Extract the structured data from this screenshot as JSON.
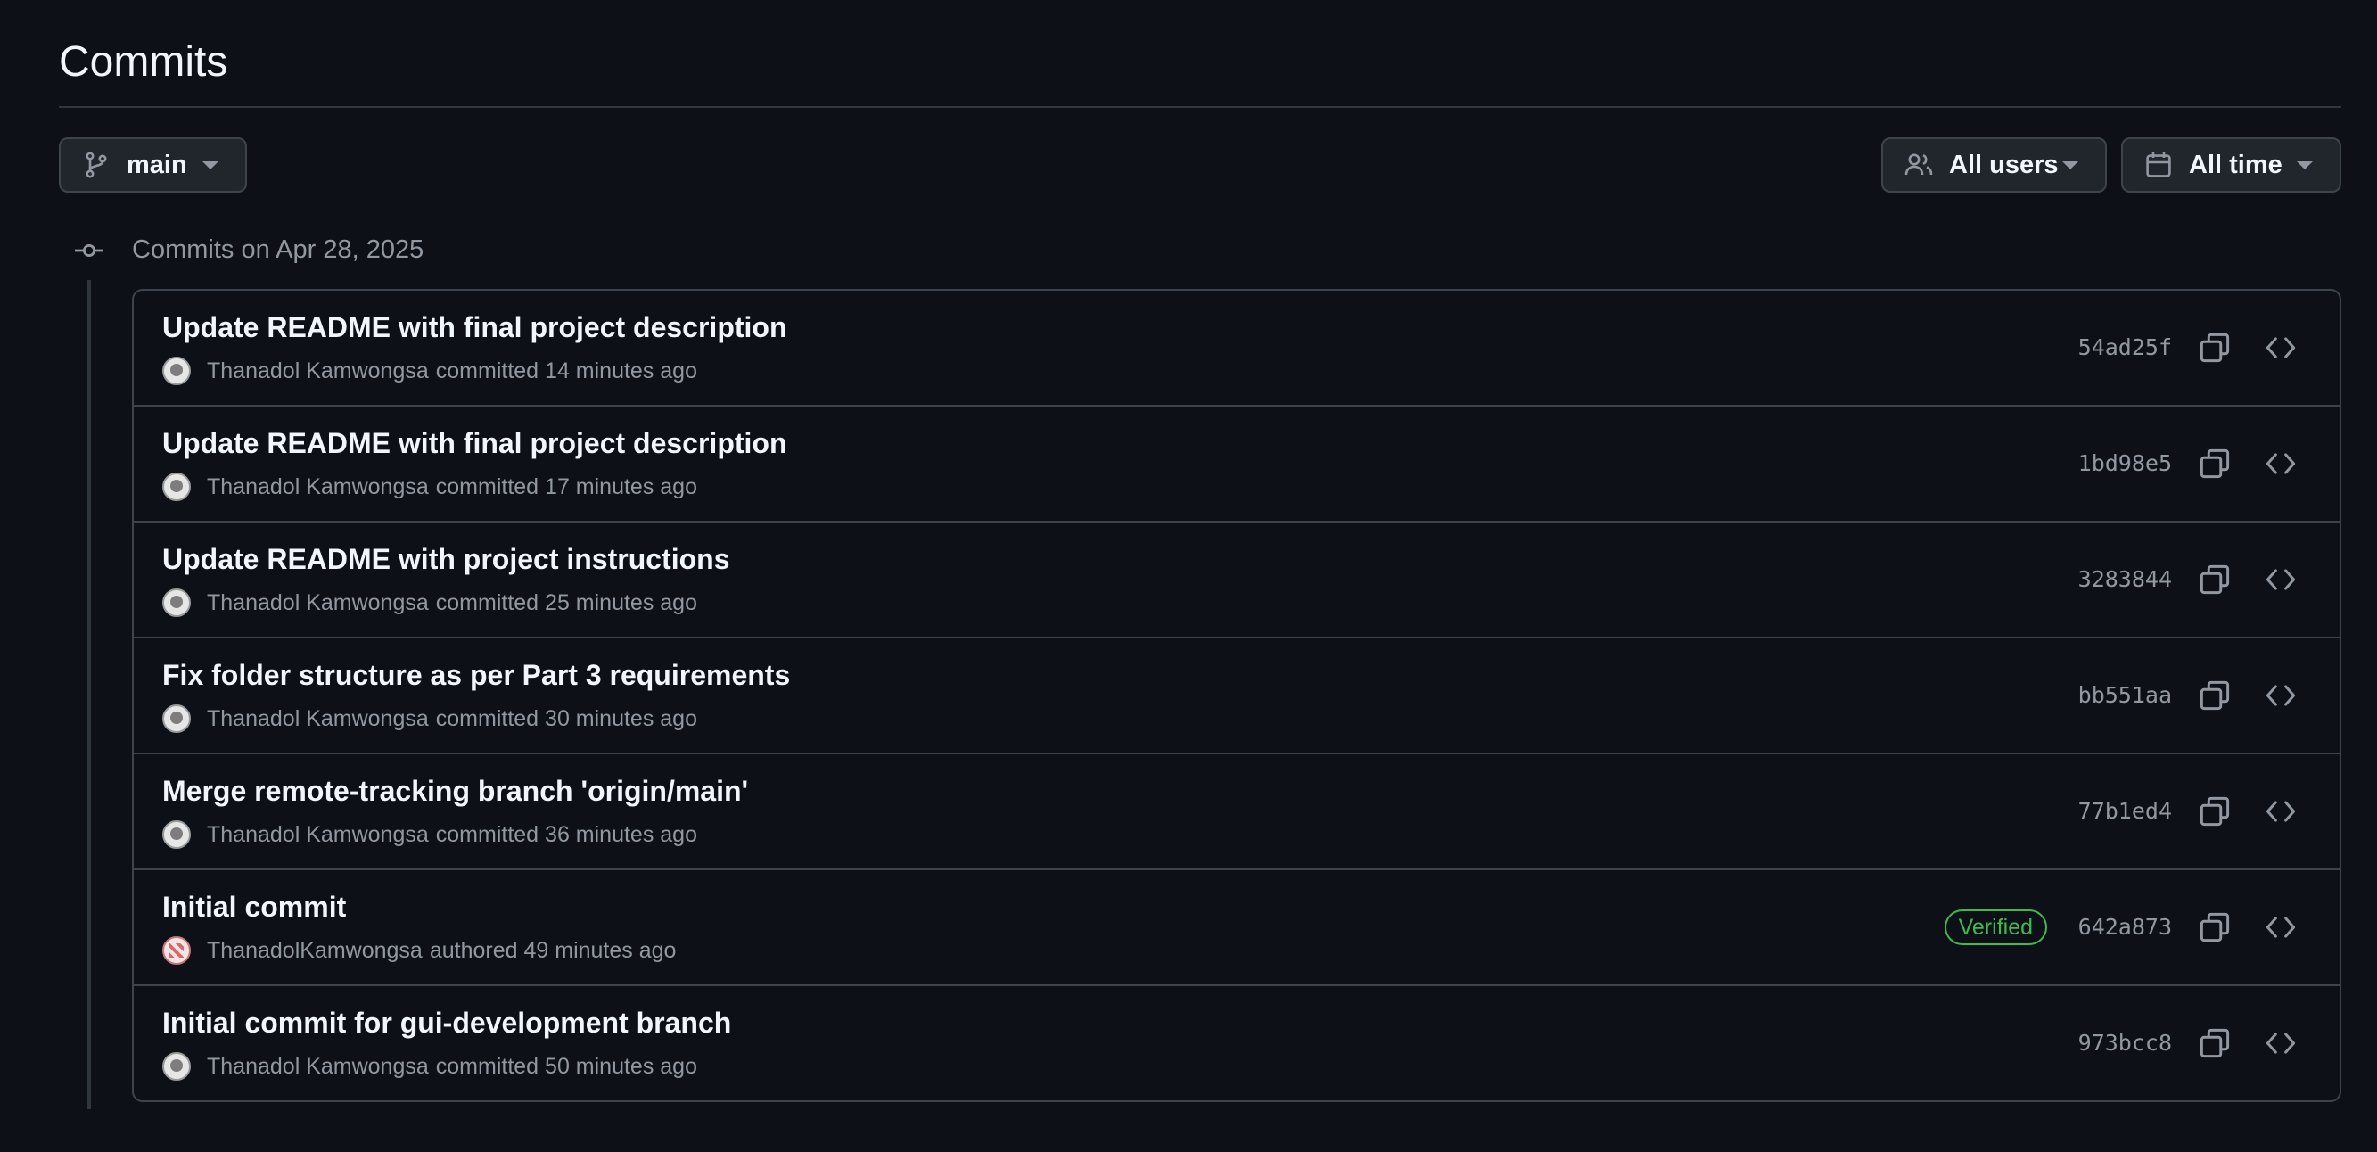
{
  "header": {
    "title": "Commits"
  },
  "filters": {
    "branch_label": "main",
    "users_label": "All users",
    "time_label": "All time"
  },
  "group": {
    "title": "Commits on Apr 28, 2025"
  },
  "commits": [
    {
      "message": "Update README with final project description",
      "author": "Thanadol Kamwongsa",
      "action": "committed",
      "time": "14 minutes ago",
      "sha": "54ad25f",
      "avatar": "github-default-avatar"
    },
    {
      "message": "Update README with final project description",
      "author": "Thanadol Kamwongsa",
      "action": "committed",
      "time": "17 minutes ago",
      "sha": "1bd98e5",
      "avatar": "github-default-avatar"
    },
    {
      "message": "Update README with project instructions",
      "author": "Thanadol Kamwongsa",
      "action": "committed",
      "time": "25 minutes ago",
      "sha": "3283844",
      "avatar": "github-default-avatar"
    },
    {
      "message": "Fix folder structure as per Part 3 requirements",
      "author": "Thanadol Kamwongsa",
      "action": "committed",
      "time": "30 minutes ago",
      "sha": "bb551aa",
      "avatar": "github-default-avatar"
    },
    {
      "message": "Merge remote-tracking branch 'origin/main'",
      "author": "Thanadol Kamwongsa",
      "action": "committed",
      "time": "36 minutes ago",
      "sha": "77b1ed4",
      "avatar": "github-default-avatar"
    },
    {
      "message": "Initial commit",
      "author": "ThanadolKamwongsa",
      "action": "authored",
      "time": "49 minutes ago",
      "sha": "642a873",
      "badge": "Verified",
      "avatar": "identicon-avatar"
    },
    {
      "message": "Initial commit for gui-development branch",
      "author": "Thanadol Kamwongsa",
      "action": "committed",
      "time": "50 minutes ago",
      "sha": "973bcc8",
      "avatar": "github-default-avatar"
    }
  ],
  "colors": {
    "background": "#0d1117",
    "border": "#3d444d",
    "text_primary": "#f0f6fc",
    "text_muted": "#9198a1",
    "verified": "#3fb950",
    "button_bg": "#21262d"
  }
}
